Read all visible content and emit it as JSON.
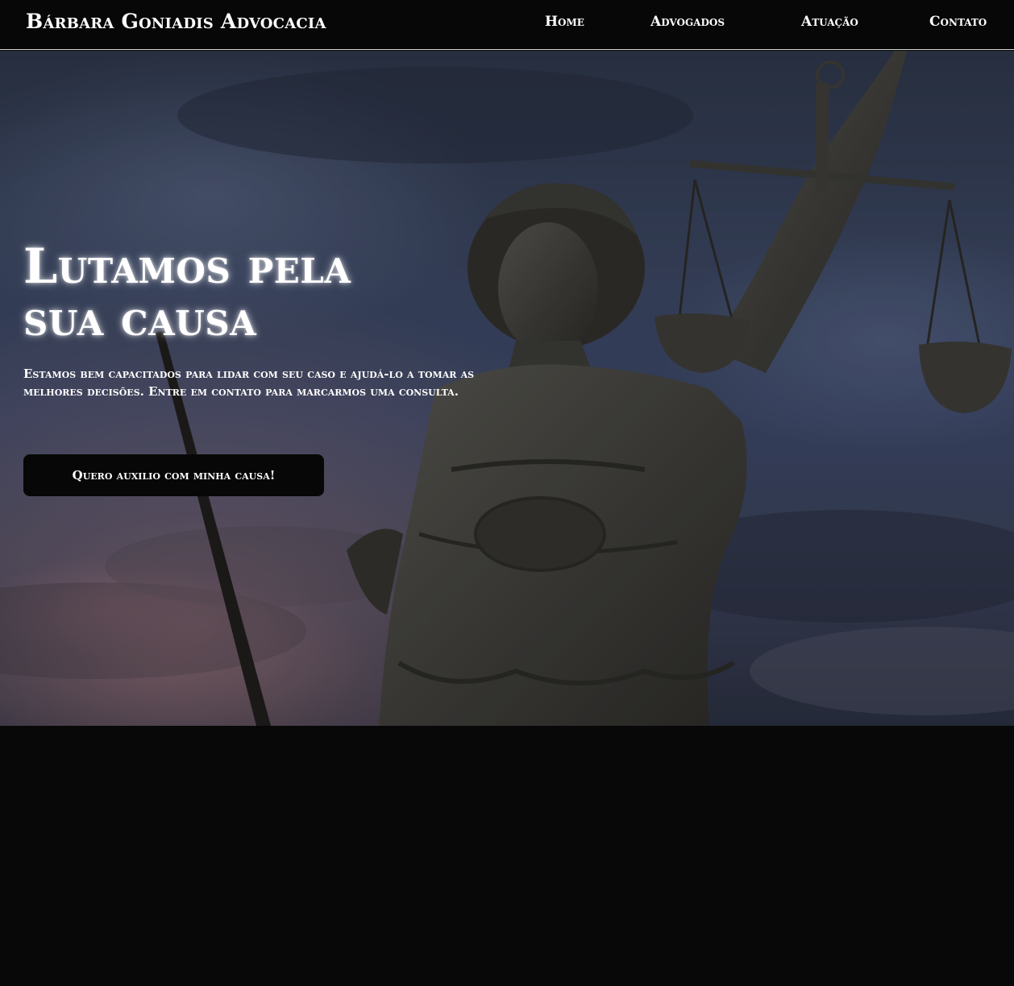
{
  "navbar": {
    "brand": "Bárbara Goniadis Advocacia",
    "links": [
      {
        "label": "Home"
      },
      {
        "label": "Advogados"
      },
      {
        "label": "Atuação"
      },
      {
        "label": "Contato"
      }
    ]
  },
  "hero": {
    "title_line1": "Lutamos pela",
    "title_line2": "sua causa",
    "subtitle": "Estamos bem capacitados para lidar com seu caso e ajudá-lo a tomar as melhores decisões. Entre em contato para marcarmos uma consulta.",
    "cta_label": "Quero auxilio com minha causa!",
    "background_icon": "lady-justice-statue-image"
  },
  "colors": {
    "navbar_bg": "#070707",
    "text": "#ffffff",
    "button_bg": "#070707",
    "page_bg": "#080808",
    "sky": "#3a4560"
  }
}
